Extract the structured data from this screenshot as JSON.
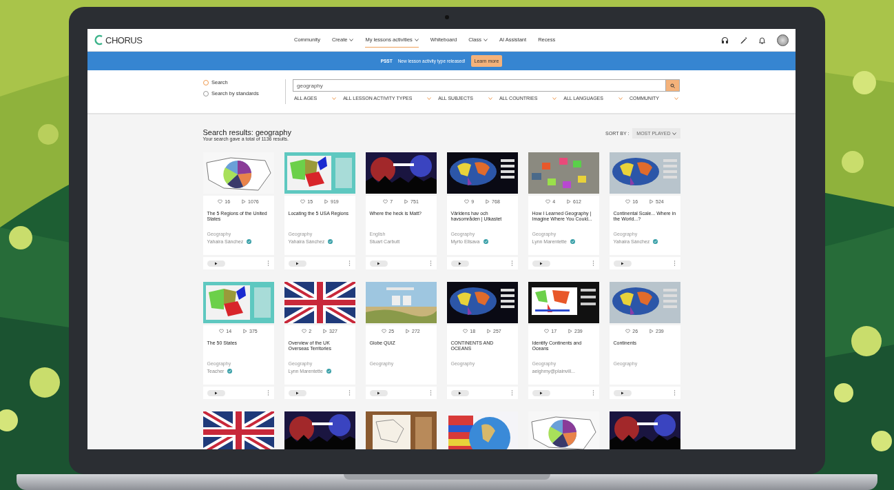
{
  "brand": {
    "name": "CHORUS"
  },
  "nav": {
    "items": [
      {
        "label": "Community",
        "dropdown": false,
        "selected": false
      },
      {
        "label": "Create",
        "dropdown": true,
        "selected": false
      },
      {
        "label": "My lessons activities",
        "dropdown": true,
        "selected": true
      },
      {
        "label": "Whiteboard",
        "dropdown": false,
        "selected": false
      },
      {
        "label": "Class",
        "dropdown": true,
        "selected": false
      },
      {
        "label": "AI Assistant",
        "dropdown": false,
        "selected": false
      },
      {
        "label": "Recess",
        "dropdown": false,
        "selected": false
      }
    ]
  },
  "banner": {
    "badge": "PSST",
    "message": "New lesson activity type released!",
    "button": "Learn more"
  },
  "search": {
    "options": [
      {
        "label": "Search",
        "selected": true
      },
      {
        "label": "Search by standards",
        "selected": false
      }
    ],
    "value": "geography",
    "filters": [
      "ALL AGES",
      "ALL LESSON ACTIVITY TYPES",
      "ALL SUBJECTS",
      "ALL COUNTRIES",
      "ALL LANGUAGES",
      "COMMUNITY"
    ]
  },
  "results": {
    "title": "Search results: geography",
    "summary": "Your search gave a total of 1136 results.",
    "sort_label": "SORT BY :",
    "sort_value": "MOST PLAYED",
    "cards": [
      {
        "image": {
          "kind": "picture"
        },
        "likes": "16",
        "plays": "1076",
        "title": "The 5 Regions of the United States",
        "subject": "Geography",
        "author": "Yahaira Sánchez",
        "verified": true
      },
      {
        "image": {
          "kind": "picture"
        },
        "likes": "15",
        "plays": "919",
        "title": "Locating the 5 USA Regions",
        "subject": "Geography",
        "author": "Yahaira Sánchez",
        "verified": true
      },
      {
        "image": {
          "kind": "picture"
        },
        "likes": "7",
        "plays": "751",
        "title": "Where the heck is Matt?",
        "subject": "English",
        "author": "Stuart Carbutt",
        "verified": false
      },
      {
        "image": {
          "kind": "picture"
        },
        "likes": "9",
        "plays": "768",
        "title": "Världens hav och havsområden | Utkastet",
        "subject": "Geography",
        "author": "Myrto Ellsava",
        "verified": true
      },
      {
        "image": {
          "kind": "picture"
        },
        "likes": "4",
        "plays": "612",
        "title": "How I Learned Geography | Imagine Where You Could...",
        "subject": "Geography",
        "author": "Lynn Marentette",
        "verified": true
      },
      {
        "image": {
          "kind": "picture"
        },
        "likes": "16",
        "plays": "524",
        "title": "Continental Scale... Where in the World...?",
        "subject": "Geography",
        "author": "Yahaira Sánchez",
        "verified": true
      },
      {
        "image": {
          "kind": "picture"
        },
        "likes": "14",
        "plays": "375",
        "title": "The 50 States",
        "subject": "Geography",
        "author": "Teacher",
        "verified": true
      },
      {
        "image": {
          "kind": "picture"
        },
        "likes": "2",
        "plays": "327",
        "title": "Overview of the UK Overseas Territories",
        "subject": "Geography",
        "author": "Lynn Marentette",
        "verified": true
      },
      {
        "image": {
          "kind": "picture"
        },
        "likes": "25",
        "plays": "272",
        "title": "Globe QUIZ",
        "subject": "Geography",
        "verified": false
      },
      {
        "image": {
          "kind": "picture"
        },
        "likes": "18",
        "plays": "257",
        "title": "CONTINENTS AND OCEANS",
        "subject": "Geography",
        "verified": false
      },
      {
        "image": {
          "kind": "picture"
        },
        "likes": "17",
        "plays": "239",
        "title": "Identify Continents and Oceans",
        "subject": "Geography",
        "author": "aeighmy@plainvill...",
        "verified": false
      },
      {
        "image": {
          "kind": "picture"
        },
        "likes": "26",
        "plays": "239",
        "title": "Continents",
        "subject": "Geography",
        "verified": false
      },
      {
        "image": {
          "kind": "picture"
        }
      },
      {
        "image": {
          "kind": "picture"
        }
      },
      {
        "image": {
          "kind": "picture"
        }
      },
      {
        "image": {
          "kind": "picture"
        }
      },
      {
        "image": {
          "kind": "picture"
        }
      },
      {
        "image": {
          "kind": "picture"
        }
      }
    ]
  }
}
